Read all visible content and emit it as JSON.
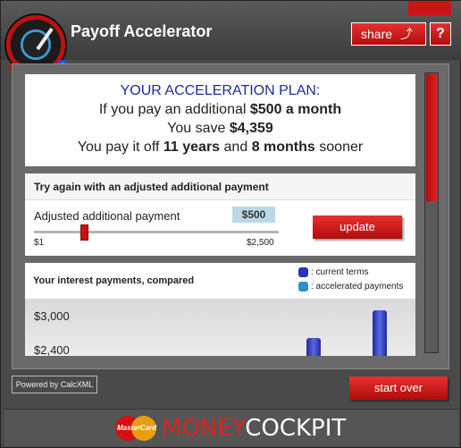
{
  "app": {
    "title": "Payoff Accelerator",
    "share_label": "share",
    "help_label": "?"
  },
  "plan": {
    "heading": "YOUR ACCELERATION PLAN:",
    "line1_prefix": "If you pay an additional",
    "line1_value": "$500 a month",
    "line2_prefix": "You save",
    "line2_value": "$4,359",
    "line3_prefix": "You pay it off",
    "line3_years": "11 years",
    "line3_and": "and",
    "line3_months": "8 months",
    "line3_suffix": "sooner"
  },
  "adjust": {
    "heading": "Try again with an adjusted additional payment",
    "label": "Adjusted additional payment",
    "value": "$500",
    "min_label": "$1",
    "max_label": "$2,500",
    "slider_fraction": 0.2,
    "update_label": "update"
  },
  "compare": {
    "heading": "Your interest payments, compared",
    "legend_current": ": current terms",
    "legend_accelerated": ": accelerated payments",
    "y_ticks": [
      "$3,000",
      "$2,400"
    ]
  },
  "footer": {
    "powered_by": "Powered by CalcXML",
    "start_over_label": "start over",
    "mastercard_text": "MasterCard",
    "brand_money": "MONEY",
    "brand_cockpit": "COCKPIT"
  },
  "colors": {
    "accent_red": "#d01010",
    "plan_heading_blue": "#1e2aa0",
    "current_terms": "#2b34b8",
    "accelerated_payments": "#2a8fd0",
    "value_badge": "#b9d9e6"
  }
}
